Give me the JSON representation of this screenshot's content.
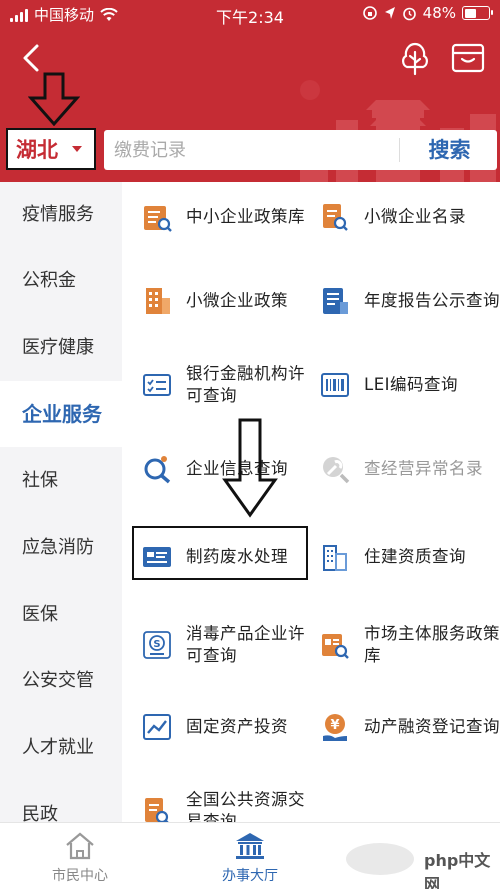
{
  "status_bar": {
    "carrier": "中国移动",
    "time": "下午2:34",
    "battery": "48%"
  },
  "header": {
    "region": "湖北",
    "search_placeholder": "缴费记录",
    "search_button": "搜索"
  },
  "sidebar": {
    "items": [
      {
        "label": "疫情服务"
      },
      {
        "label": "公积金"
      },
      {
        "label": "医疗健康"
      },
      {
        "label": "企业服务"
      },
      {
        "label": "社保"
      },
      {
        "label": "应急消防"
      },
      {
        "label": "医保"
      },
      {
        "label": "公安交管"
      },
      {
        "label": "人才就业"
      },
      {
        "label": "民政"
      }
    ],
    "active_index": 3
  },
  "services": {
    "left": [
      {
        "label": "中小企业政策库",
        "icon": "policy-list-icon"
      },
      {
        "label": "小微企业政策",
        "icon": "building-icon"
      },
      {
        "label": "银行金融机构许可查询",
        "icon": "checklist-card-icon"
      },
      {
        "label": "企业信息查询",
        "icon": "magnifier-company-icon"
      },
      {
        "label": "制药废水处理",
        "icon": "id-card-icon"
      },
      {
        "label": "消毒产品企业许可查询",
        "icon": "certificate-seal-icon"
      },
      {
        "label": "固定资产投资",
        "icon": "line-chart-icon"
      },
      {
        "label": "全国公共资源交易查询",
        "icon": "document-search-icon"
      }
    ],
    "right": [
      {
        "label": "小微企业名录",
        "icon": "document-search-icon"
      },
      {
        "label": "年度报告公示查询",
        "icon": "report-icon"
      },
      {
        "label": "LEI编码查询",
        "icon": "barcode-icon"
      },
      {
        "label": "查经营异常名录",
        "icon": "wrench-magnifier-icon"
      },
      {
        "label": "住建资质查询",
        "icon": "buildings-icon"
      },
      {
        "label": "市场主体服务政策库",
        "icon": "market-policy-icon"
      },
      {
        "label": "动产融资登记查询",
        "icon": "yuan-hand-icon"
      }
    ]
  },
  "bottom_nav": {
    "tabs": [
      {
        "label": "市民中心",
        "icon": "home-icon"
      },
      {
        "label": "办事大厅",
        "icon": "bank-icon"
      }
    ],
    "active_index": 1
  },
  "watermark": "php中文网",
  "colors": {
    "header_red": "#c52c34",
    "accent_blue": "#2e67b1",
    "icon_orange": "#e0833a"
  }
}
